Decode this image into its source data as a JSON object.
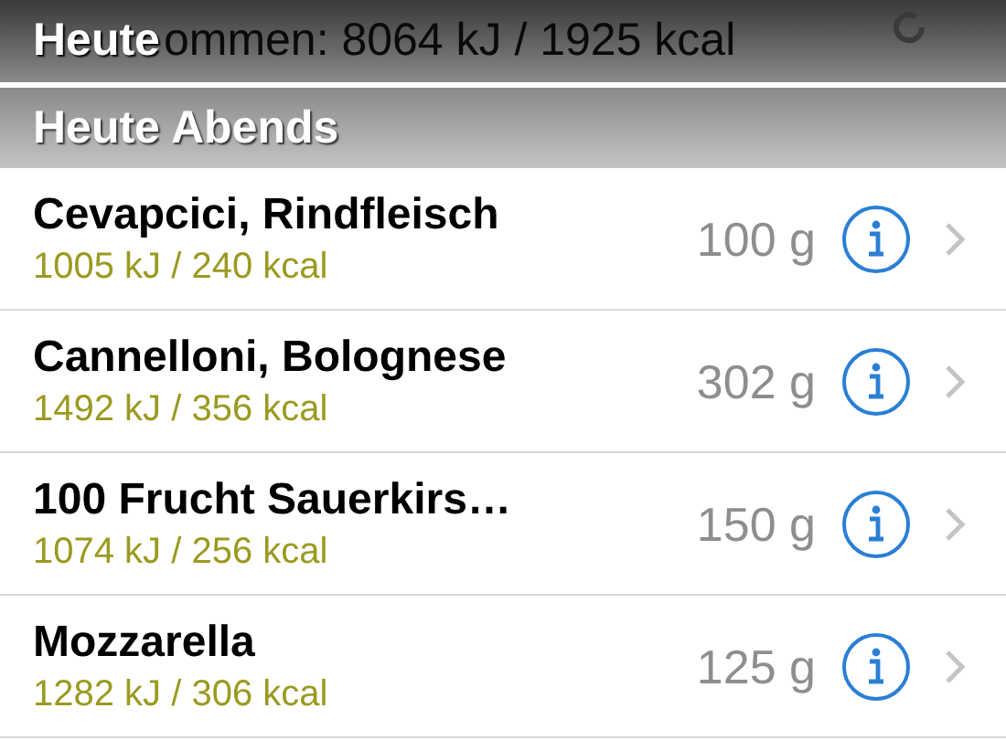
{
  "header": {
    "title": "Heute",
    "behind_text": "ommen: 8064 kJ / 1925 kcal"
  },
  "section": {
    "title": "Heute Abends"
  },
  "items": [
    {
      "name": "Cevapcici, Rindfleisch",
      "energy": "1005 kJ / 240 kcal",
      "amount": "100 g"
    },
    {
      "name": "Cannelloni, Bolognese",
      "energy": "1492 kJ / 356 kcal",
      "amount": "302 g"
    },
    {
      "name": "100 Frucht Sauerkirs…",
      "energy": "1074 kJ / 256 kcal",
      "amount": "150 g"
    },
    {
      "name": "Mozzarella",
      "energy": "1282 kJ / 306 kcal",
      "amount": "125 g"
    }
  ]
}
